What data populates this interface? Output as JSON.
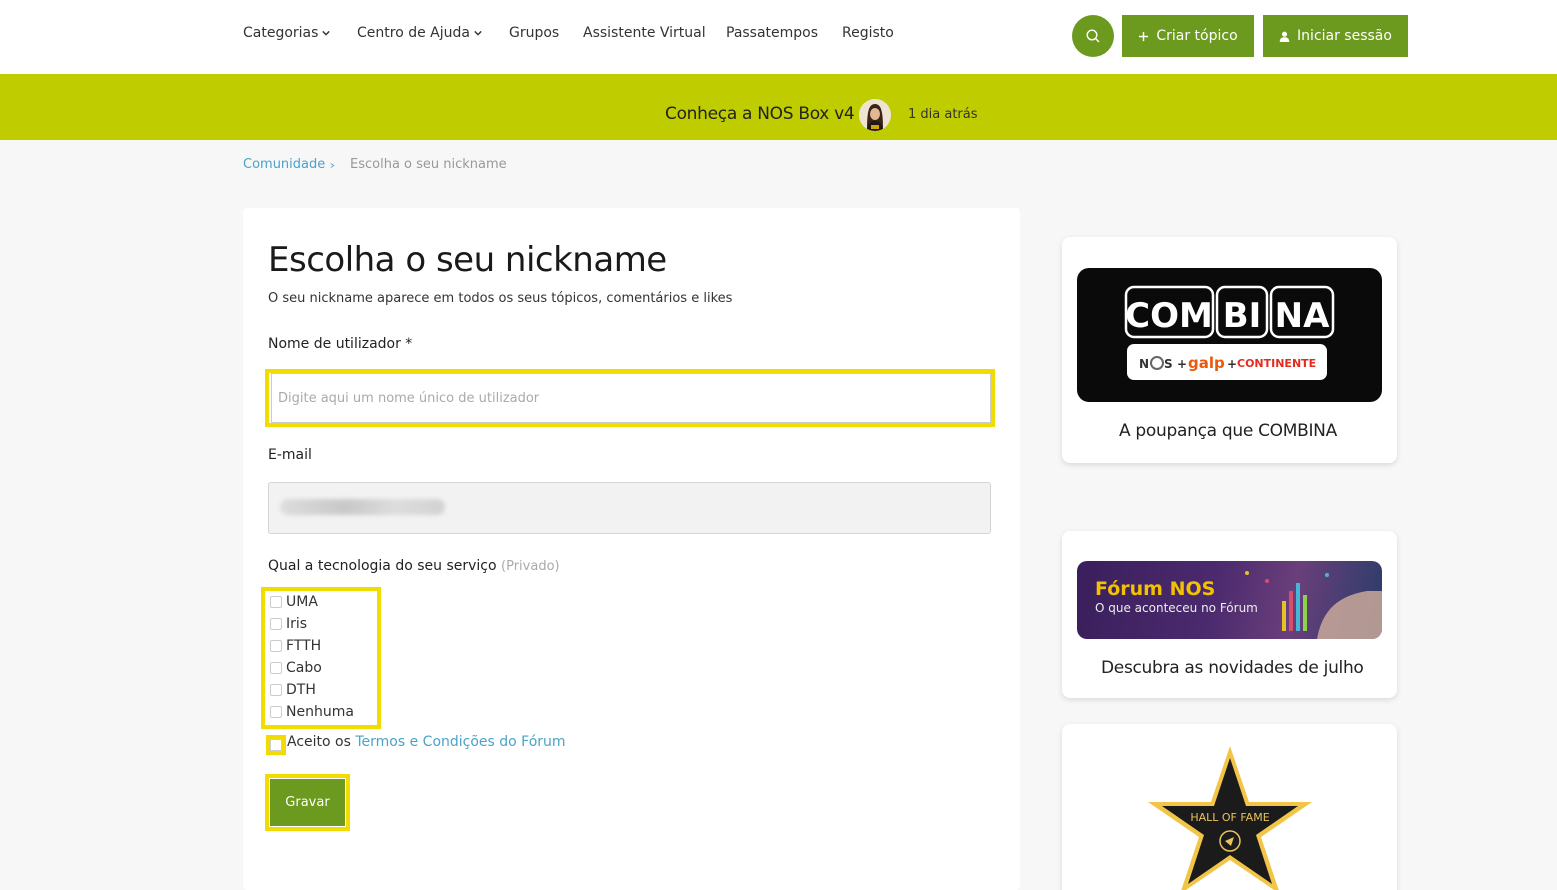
{
  "nav": {
    "items": [
      {
        "label": "Categorias",
        "has_dropdown": true
      },
      {
        "label": "Centro de Ajuda",
        "has_dropdown": true
      },
      {
        "label": "Grupos",
        "has_dropdown": false
      },
      {
        "label": "Assistente Virtual",
        "has_dropdown": false
      },
      {
        "label": "Passatempos",
        "has_dropdown": false
      },
      {
        "label": "Registo",
        "has_dropdown": false
      }
    ],
    "create_topic": "Criar tópico",
    "sign_in": "Iniciar sessão"
  },
  "announcement": {
    "title": "Conheça a NOS Box v4",
    "time": "1 dia atrás"
  },
  "breadcrumb": {
    "root": "Comunidade",
    "current": "Escolha o seu nickname"
  },
  "form": {
    "title": "Escolha o seu nickname",
    "subtitle": "O seu nickname aparece em todos os seus tópicos, comentários e likes",
    "username_label": "Nome de utilizador *",
    "username_placeholder": "Digite aqui um nome único de utilizador",
    "email_label": "E-mail",
    "tech_label": "Qual a tecnologia do seu serviço",
    "tech_private": "(Privado)",
    "tech_options": [
      "UMA",
      "Iris",
      "FTTH",
      "Cabo",
      "DTH",
      "Nenhuma"
    ],
    "terms_prefix": "Aceito os",
    "terms_link": "Termos e Condições do Fórum",
    "save": "Gravar"
  },
  "sidebar": {
    "combina": {
      "logo_text": [
        "COM",
        "BI",
        "NA"
      ],
      "partners": [
        "N",
        "S",
        "+",
        "galp",
        "+",
        "CONTINENTE"
      ],
      "caption": "A poupança que COMBINA"
    },
    "forum": {
      "title": "Fórum NOS",
      "subtitle": "O que aconteceu no Fórum",
      "caption": "Descubra as novidades de julho"
    },
    "hall": {
      "text": "HALL OF FAME"
    }
  },
  "colors": {
    "brand_green": "#6b9a1f",
    "banner_lime": "#bfcc00",
    "highlight_yellow": "#f2dc00",
    "link_blue": "#4aa3c9"
  }
}
